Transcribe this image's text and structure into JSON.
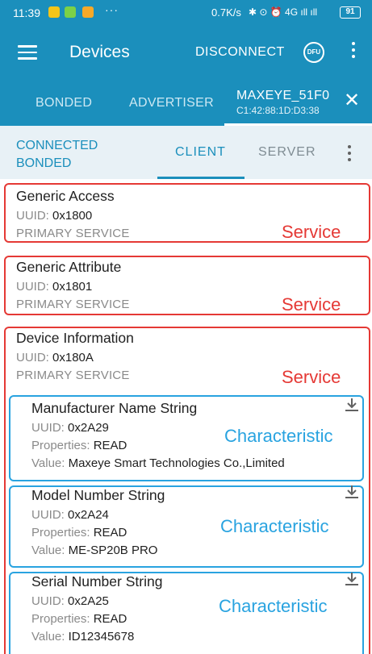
{
  "status_bar": {
    "time": "11:39",
    "dots": "···",
    "speed": "0.7K/s",
    "system_icons": "✱ ⊙ ⏰ 4G ıll ıll",
    "battery": "91"
  },
  "toolbar": {
    "title": "Devices",
    "disconnect_label": "DISCONNECT",
    "dfu_label": "DFU"
  },
  "tabs": {
    "bonded": "BONDED",
    "advertiser": "ADVERTISER",
    "device_name": "MAXEYE_51F0",
    "device_address": "C1:42:88:1D:D3:38",
    "close_symbol": "✕"
  },
  "subtabs": {
    "status_line1": "CONNECTED",
    "status_line2": "BONDED",
    "client": "CLIENT",
    "server": "SERVER"
  },
  "services": [
    {
      "name": "Generic Access",
      "uuid_label": "UUID:",
      "uuid": "0x1800",
      "type": "PRIMARY SERVICE"
    },
    {
      "name": "Generic Attribute",
      "uuid_label": "UUID:",
      "uuid": "0x1801",
      "type": "PRIMARY SERVICE"
    },
    {
      "name": "Device Information",
      "uuid_label": "UUID:",
      "uuid": "0x180A",
      "type": "PRIMARY SERVICE"
    }
  ],
  "characteristics": [
    {
      "name": "Manufacturer Name String",
      "uuid_label": "UUID:",
      "uuid": "0x2A29",
      "props_label": "Properties:",
      "props": "READ",
      "value_label": "Value:",
      "value": "Maxeye Smart Technologies Co.,Limited"
    },
    {
      "name": "Model Number String",
      "uuid_label": "UUID:",
      "uuid": "0x2A24",
      "props_label": "Properties:",
      "props": "READ",
      "value_label": "Value:",
      "value": "ME-SP20B PRO"
    },
    {
      "name": "Serial Number String",
      "uuid_label": "UUID:",
      "uuid": "0x2A25",
      "props_label": "Properties:",
      "props": "READ",
      "value_label": "Value:",
      "value": "ID12345678"
    }
  ],
  "annotations": {
    "service": "Service",
    "characteristic": "Characteristic"
  },
  "colors": {
    "primary": "#1b8fbc",
    "annotation_red": "#e53935",
    "annotation_blue": "#29a3e0"
  }
}
